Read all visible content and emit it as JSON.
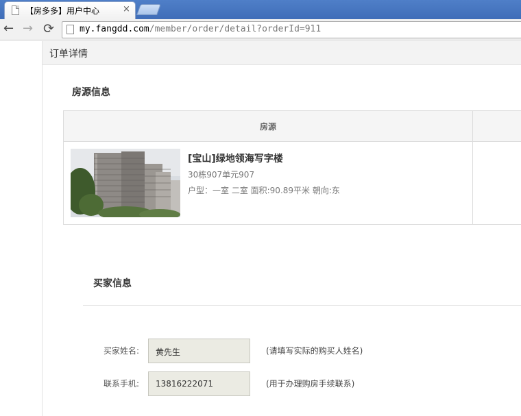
{
  "browser": {
    "tab_title": "【房多多】用户中心",
    "tab_close": "×",
    "url_host": "my.fangdd.com",
    "url_path": "/member/order/detail?orderId=911"
  },
  "page": {
    "title": "订单详情"
  },
  "house_section": {
    "title": "房源信息",
    "table_header": "房源",
    "house": {
      "name": "[宝山]绿地领海写字楼",
      "unit": "30栋907单元907",
      "detail": "户型：一室 二室 面积:90.89平米 朝向:东"
    }
  },
  "buyer_section": {
    "title": "买家信息",
    "name_label": "买家姓名:",
    "name_value": "黄先生",
    "name_hint": "(请填写实际的购买人姓名)",
    "phone_label": "联系手机:",
    "phone_value": "13816222071",
    "phone_hint": "(用于办理购房手续联系)"
  },
  "icons": {
    "back": "←",
    "forward": "→",
    "reload": "⟳"
  }
}
